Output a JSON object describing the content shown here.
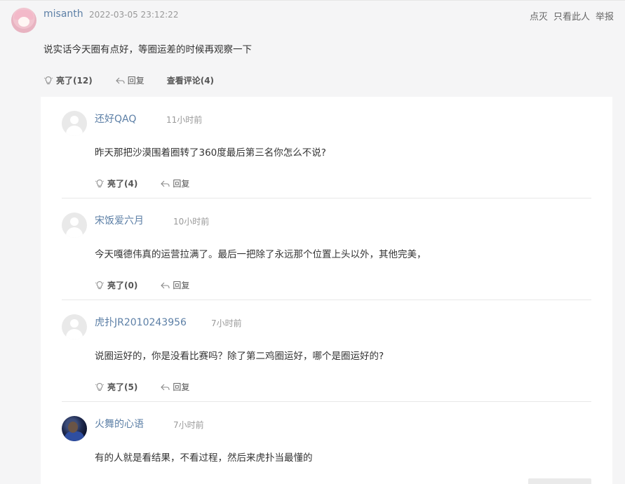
{
  "post": {
    "username": "misanth",
    "time": "2022-03-05 23:12:22",
    "actions": [
      "点灭",
      "只看此人",
      "举报"
    ],
    "text": "说实话今天圈有点好，等圈运差的时候再观察一下",
    "like_label": "亮了",
    "like_count": "(12)",
    "reply_label": "回复",
    "comments_label": "查看评论",
    "comments_count": "(4)"
  },
  "comments": [
    {
      "username": "还好QAQ",
      "time": "11小时前",
      "text": "昨天那把沙漠围着圈转了360度最后第三名你怎么不说?",
      "like_label": "亮了",
      "like_count": "(4)",
      "reply_label": "回复"
    },
    {
      "username": "宋饭爱六月",
      "time": "10小时前",
      "text": "今天嘎德伟真的运营拉满了。最后一把除了永远那个位置上头以外，其他完美，",
      "like_label": "亮了",
      "like_count": "(0)",
      "reply_label": "回复"
    },
    {
      "username": "虎扑JR2010243956",
      "time": "7小时前",
      "text": "说圈运好的，你是没看比赛吗？除了第二鸡圈运好，哪个是圈运好的?",
      "like_label": "亮了",
      "like_count": "(5)",
      "reply_label": "回复"
    },
    {
      "username": "火舞的心语",
      "time": "7小时前",
      "text": "有的人就是看结果，不看过程，然后来虎扑当最懂的"
    }
  ],
  "icons": {
    "like": "lightbulb-icon",
    "reply": "reply-arrow-icon"
  },
  "colors": {
    "username": "#5c7fa6",
    "background": "#f5f5f6",
    "card": "#ffffff"
  }
}
